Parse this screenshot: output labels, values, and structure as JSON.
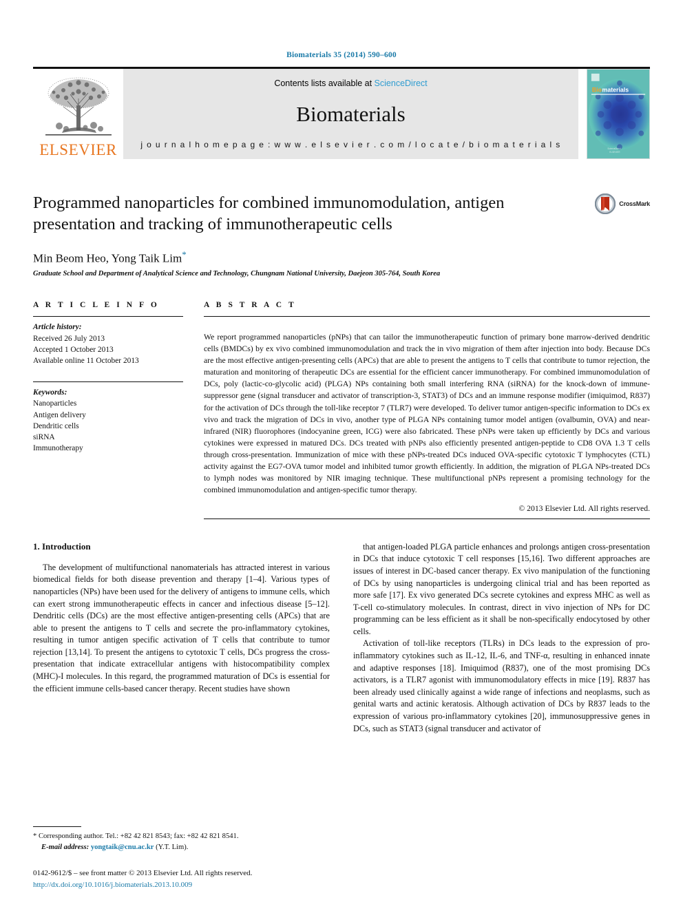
{
  "citation": "Biomaterials 35 (2014) 590–600",
  "masthead": {
    "contents_prefix": "Contents lists available at ",
    "sciencedirect": "ScienceDirect",
    "journal_name": "Biomaterials",
    "homepage": "j o u r n a l   h o m e p a g e :   w w w . e l s e v i e r . c o m / l o c a t e / b i o m a t e r i a l s",
    "publisher": "ELSEVIER",
    "cover_title_1": "Bio",
    "cover_title_2": "materials",
    "accent_blue": "#1a7aa8",
    "elsevier_orange": "#E87722",
    "masthead_bg": "#e6e6e6"
  },
  "article": {
    "title": "Programmed nanoparticles for combined immunomodulation, antigen presentation and tracking of immunotherapeutic cells",
    "authors": "Min Beom Heo, Yong Taik Lim",
    "author_marker": "*",
    "affiliation": "Graduate School and Department of Analytical Science and Technology, Chungnam National University, Daejeon 305-764, South Korea",
    "crossmark_label": "CrossMark"
  },
  "article_info": {
    "heading": "A R T I C L E   I N F O",
    "history_label": "Article history:",
    "history": [
      "Received 26 July 2013",
      "Accepted 1 October 2013",
      "Available online 11 October 2013"
    ],
    "keywords_label": "Keywords:",
    "keywords": [
      "Nanoparticles",
      "Antigen delivery",
      "Dendritic cells",
      "siRNA",
      "Immunotherapy"
    ]
  },
  "abstract": {
    "heading": "A B S T R A C T",
    "text": "We report programmed nanoparticles (pNPs) that can tailor the immunotherapeutic function of primary bone marrow-derived dendritic cells (BMDCs) by ex vivo combined immunomodulation and track the in vivo migration of them after injection into body. Because DCs are the most effective antigen-presenting cells (APCs) that are able to present the antigens to T cells that contribute to tumor rejection, the maturation and monitoring of therapeutic DCs are essential for the efficient cancer immunotherapy. For combined immunomodulation of DCs, poly (lactic-co-glycolic acid) (PLGA) NPs containing both small interfering RNA (siRNA) for the knock-down of immune-suppressor gene (signal transducer and activator of transcription-3, STAT3) of DCs and an immune response modifier (imiquimod, R837) for the activation of DCs through the toll-like receptor 7 (TLR7) were developed. To deliver tumor antigen-specific information to DCs ex vivo and track the migration of DCs in vivo, another type of PLGA NPs containing tumor model antigen (ovalbumin, OVA) and near-infrared (NIR) fluorophores (indocyanine green, ICG) were also fabricated. These pNPs were taken up efficiently by DCs and various cytokines were expressed in matured DCs. DCs treated with pNPs also efficiently presented antigen-peptide to CD8 OVA 1.3 T cells through cross-presentation. Immunization of mice with these pNPs-treated DCs induced OVA-specific cytotoxic T lymphocytes (CTL) activity against the EG7-OVA tumor model and inhibited tumor growth efficiently. In addition, the migration of PLGA NPs-treated DCs to lymph nodes was monitored by NIR imaging technique. These multifunctional pNPs represent a promising technology for the combined immunomodulation and antigen-specific tumor therapy.",
    "copyright": "© 2013 Elsevier Ltd. All rights reserved."
  },
  "introduction": {
    "section_title": "1.  Introduction",
    "left_para_1": "The development of multifunctional nanomaterials has attracted interest in various biomedical fields for both disease prevention and therapy [1–4]. Various types of nanoparticles (NPs) have been used for the delivery of antigens to immune cells, which can exert strong immunotherapeutic effects in cancer and infectious disease [5–12]. Dendritic cells (DCs) are the most effective antigen-presenting cells (APCs) that are able to present the antigens to T cells and secrete the pro-inflammatory cytokines, resulting in tumor antigen specific activation of T cells that contribute to tumor rejection [13,14]. To present the antigens to cytotoxic T cells, DCs progress the cross-presentation that indicate extracellular antigens with histocompatibility complex (MHC)-I molecules. In this regard, the programmed maturation of DCs is essential for the efficient immune cells-based cancer therapy. Recent studies have shown",
    "right_para_1": "that antigen-loaded PLGA particle enhances and prolongs antigen cross-presentation in DCs that induce cytotoxic T cell responses [15,16]. Two different approaches are issues of interest in DC-based cancer therapy. Ex vivo manipulation of the functioning of DCs by using nanoparticles is undergoing clinical trial and has been reported as more safe [17]. Ex vivo generated DCs secrete cytokines and express MHC as well as T-cell co-stimulatory molecules. In contrast, direct in vivo injection of NPs for DC programming can be less efficient as it shall be non-specifically endocytosed by other cells.",
    "right_para_2": "Activation of toll-like receptors (TLRs) in DCs leads to the expression of pro-inflammatory cytokines such as IL-12, IL-6, and TNF-α, resulting in enhanced innate and adaptive responses [18]. Imiquimod (R837), one of the most promising DCs activators, is a TLR7 agonist with immunomodulatory effects in mice [19]. R837 has been already used clinically against a wide range of infections and neoplasms, such as genital warts and actinic keratosis. Although activation of DCs by R837 leads to the expression of various pro-inflammatory cytokines [20], immunosuppressive genes in DCs, such as STAT3 (signal transducer and activator of"
  },
  "footnote": {
    "corresponding": "* Corresponding author. Tel.: +82 42 821 8543; fax: +82 42 821 8541.",
    "email_label": "E-mail address:",
    "email": "yongtaik@cnu.ac.kr",
    "email_suffix": "(Y.T. Lim)."
  },
  "footer": {
    "issn_line": "0142-9612/$ – see front matter © 2013 Elsevier Ltd. All rights reserved.",
    "doi": "http://dx.doi.org/10.1016/j.biomaterials.2013.10.009"
  }
}
